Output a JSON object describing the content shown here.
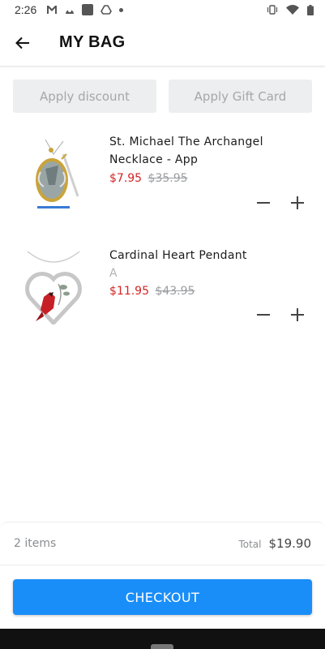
{
  "status_bar": {
    "time": "2:26"
  },
  "header": {
    "title": "MY BAG"
  },
  "actions": {
    "discount_label": "Apply discount",
    "gift_card_label": "Apply Gift Card"
  },
  "items": [
    {
      "name": "St. Michael The Archangel Necklace - App",
      "variant": "",
      "sale_price": "$7.95",
      "original_price": "$35.95"
    },
    {
      "name": "Cardinal Heart Pendant",
      "variant": "A",
      "sale_price": "$11.95",
      "original_price": "$43.95"
    }
  ],
  "summary": {
    "items_count": "2 items",
    "total_label": "Total",
    "total_value": "$19.90"
  },
  "checkout": {
    "label": "CHECKOUT"
  },
  "colors": {
    "accent": "#1a8ef8",
    "sale": "#d32525",
    "muted": "#9a9da0"
  }
}
